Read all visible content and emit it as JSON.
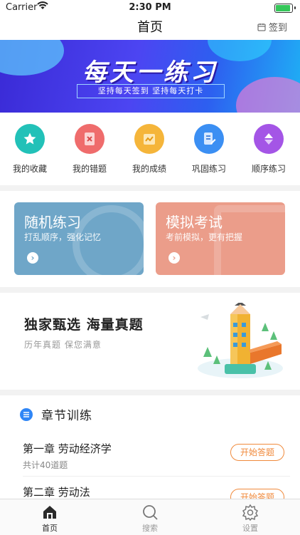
{
  "status": {
    "carrier": "Carrier",
    "time": "2:30 PM",
    "battery_level": 0.9
  },
  "nav": {
    "title": "首页",
    "checkin_label": "签到"
  },
  "banner": {
    "headline": "每天一练习",
    "subline": "坚持每天签到  坚持每天打卡"
  },
  "quick_actions": [
    {
      "label": "我的收藏",
      "icon": "star-icon",
      "color": "#22c1b8"
    },
    {
      "label": "我的错题",
      "icon": "wrong-book-icon",
      "color": "#ef6c6c"
    },
    {
      "label": "我的成绩",
      "icon": "score-icon",
      "color": "#f5b53a"
    },
    {
      "label": "巩固练习",
      "icon": "doc-edit-icon",
      "color": "#3b8ff3"
    },
    {
      "label": "顺序练习",
      "icon": "sort-icon",
      "color": "#a455e6"
    }
  ],
  "cards": [
    {
      "title": "随机练习",
      "subtitle": "打乱顺序，强化记忆",
      "color": "#6fa6c8"
    },
    {
      "title": "模拟考试",
      "subtitle": "考前模拟，更有把握",
      "color": "#eb9d8a"
    }
  ],
  "promo": {
    "title": "独家甄选 海量真题",
    "subtitle": "历年真题 保您满意"
  },
  "section": {
    "title": "章节训练"
  },
  "chapters": [
    {
      "title": "第一章 劳动经济学",
      "count": "共计40道题",
      "button": "开始答题"
    },
    {
      "title": "第二章 劳动法",
      "count": "",
      "button": "开始答题"
    }
  ],
  "tabs": [
    {
      "label": "首页",
      "icon": "home-icon",
      "active": true
    },
    {
      "label": "搜索",
      "icon": "search-icon",
      "active": false
    },
    {
      "label": "设置",
      "icon": "gear-icon",
      "active": false
    }
  ],
  "colors": {
    "accent_orange": "#f08a3c",
    "active_tab": "#2a2a2a",
    "inactive_tab": "#999999"
  }
}
